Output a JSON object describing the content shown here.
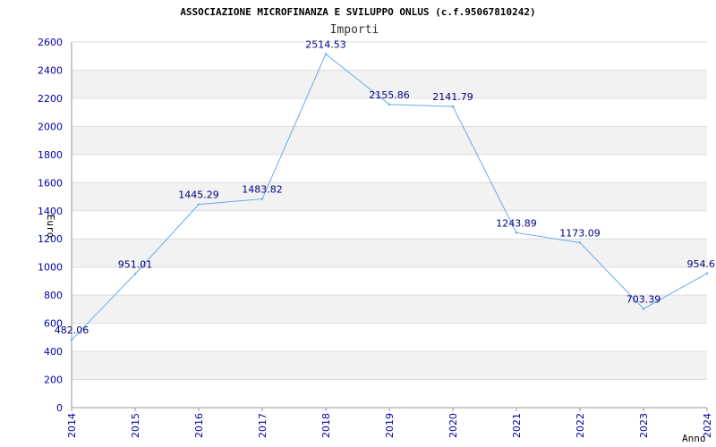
{
  "colors": {
    "line": "#66aaee",
    "band": "#f2f2f2",
    "grid": "#dddddd",
    "axis": "#999999",
    "tick_text": "#0000aa",
    "label_text": "#000080"
  },
  "chart_data": {
    "type": "line",
    "title": "ASSOCIAZIONE MICROFINANZA E SVILUPPO ONLUS (c.f.95067810242)",
    "subtitle": "Importi",
    "xlabel": "Anno",
    "ylabel": "Euro",
    "x": [
      "2014",
      "2015",
      "2016",
      "2017",
      "2018",
      "2019",
      "2020",
      "2021",
      "2022",
      "2023",
      "2024"
    ],
    "series": [
      {
        "values": [
          482.06,
          951.01,
          1445.29,
          1483.82,
          2514.53,
          2155.86,
          2141.79,
          1243.89,
          1173.09,
          703.39,
          954.6
        ],
        "labels": [
          "482.06",
          "951.01",
          "1445.29",
          "1483.82",
          "2514.53",
          "2155.86",
          "2141.79",
          "1243.89",
          "1173.09",
          "703.39",
          "954.6"
        ]
      }
    ],
    "ylim": [
      0,
      2600
    ],
    "yticks": [
      "0",
      "200",
      "400",
      "600",
      "800",
      "1000",
      "1200",
      "1400",
      "1600",
      "1800",
      "2000",
      "2200",
      "2400",
      "2600"
    ],
    "grid": true,
    "legend": "none"
  }
}
